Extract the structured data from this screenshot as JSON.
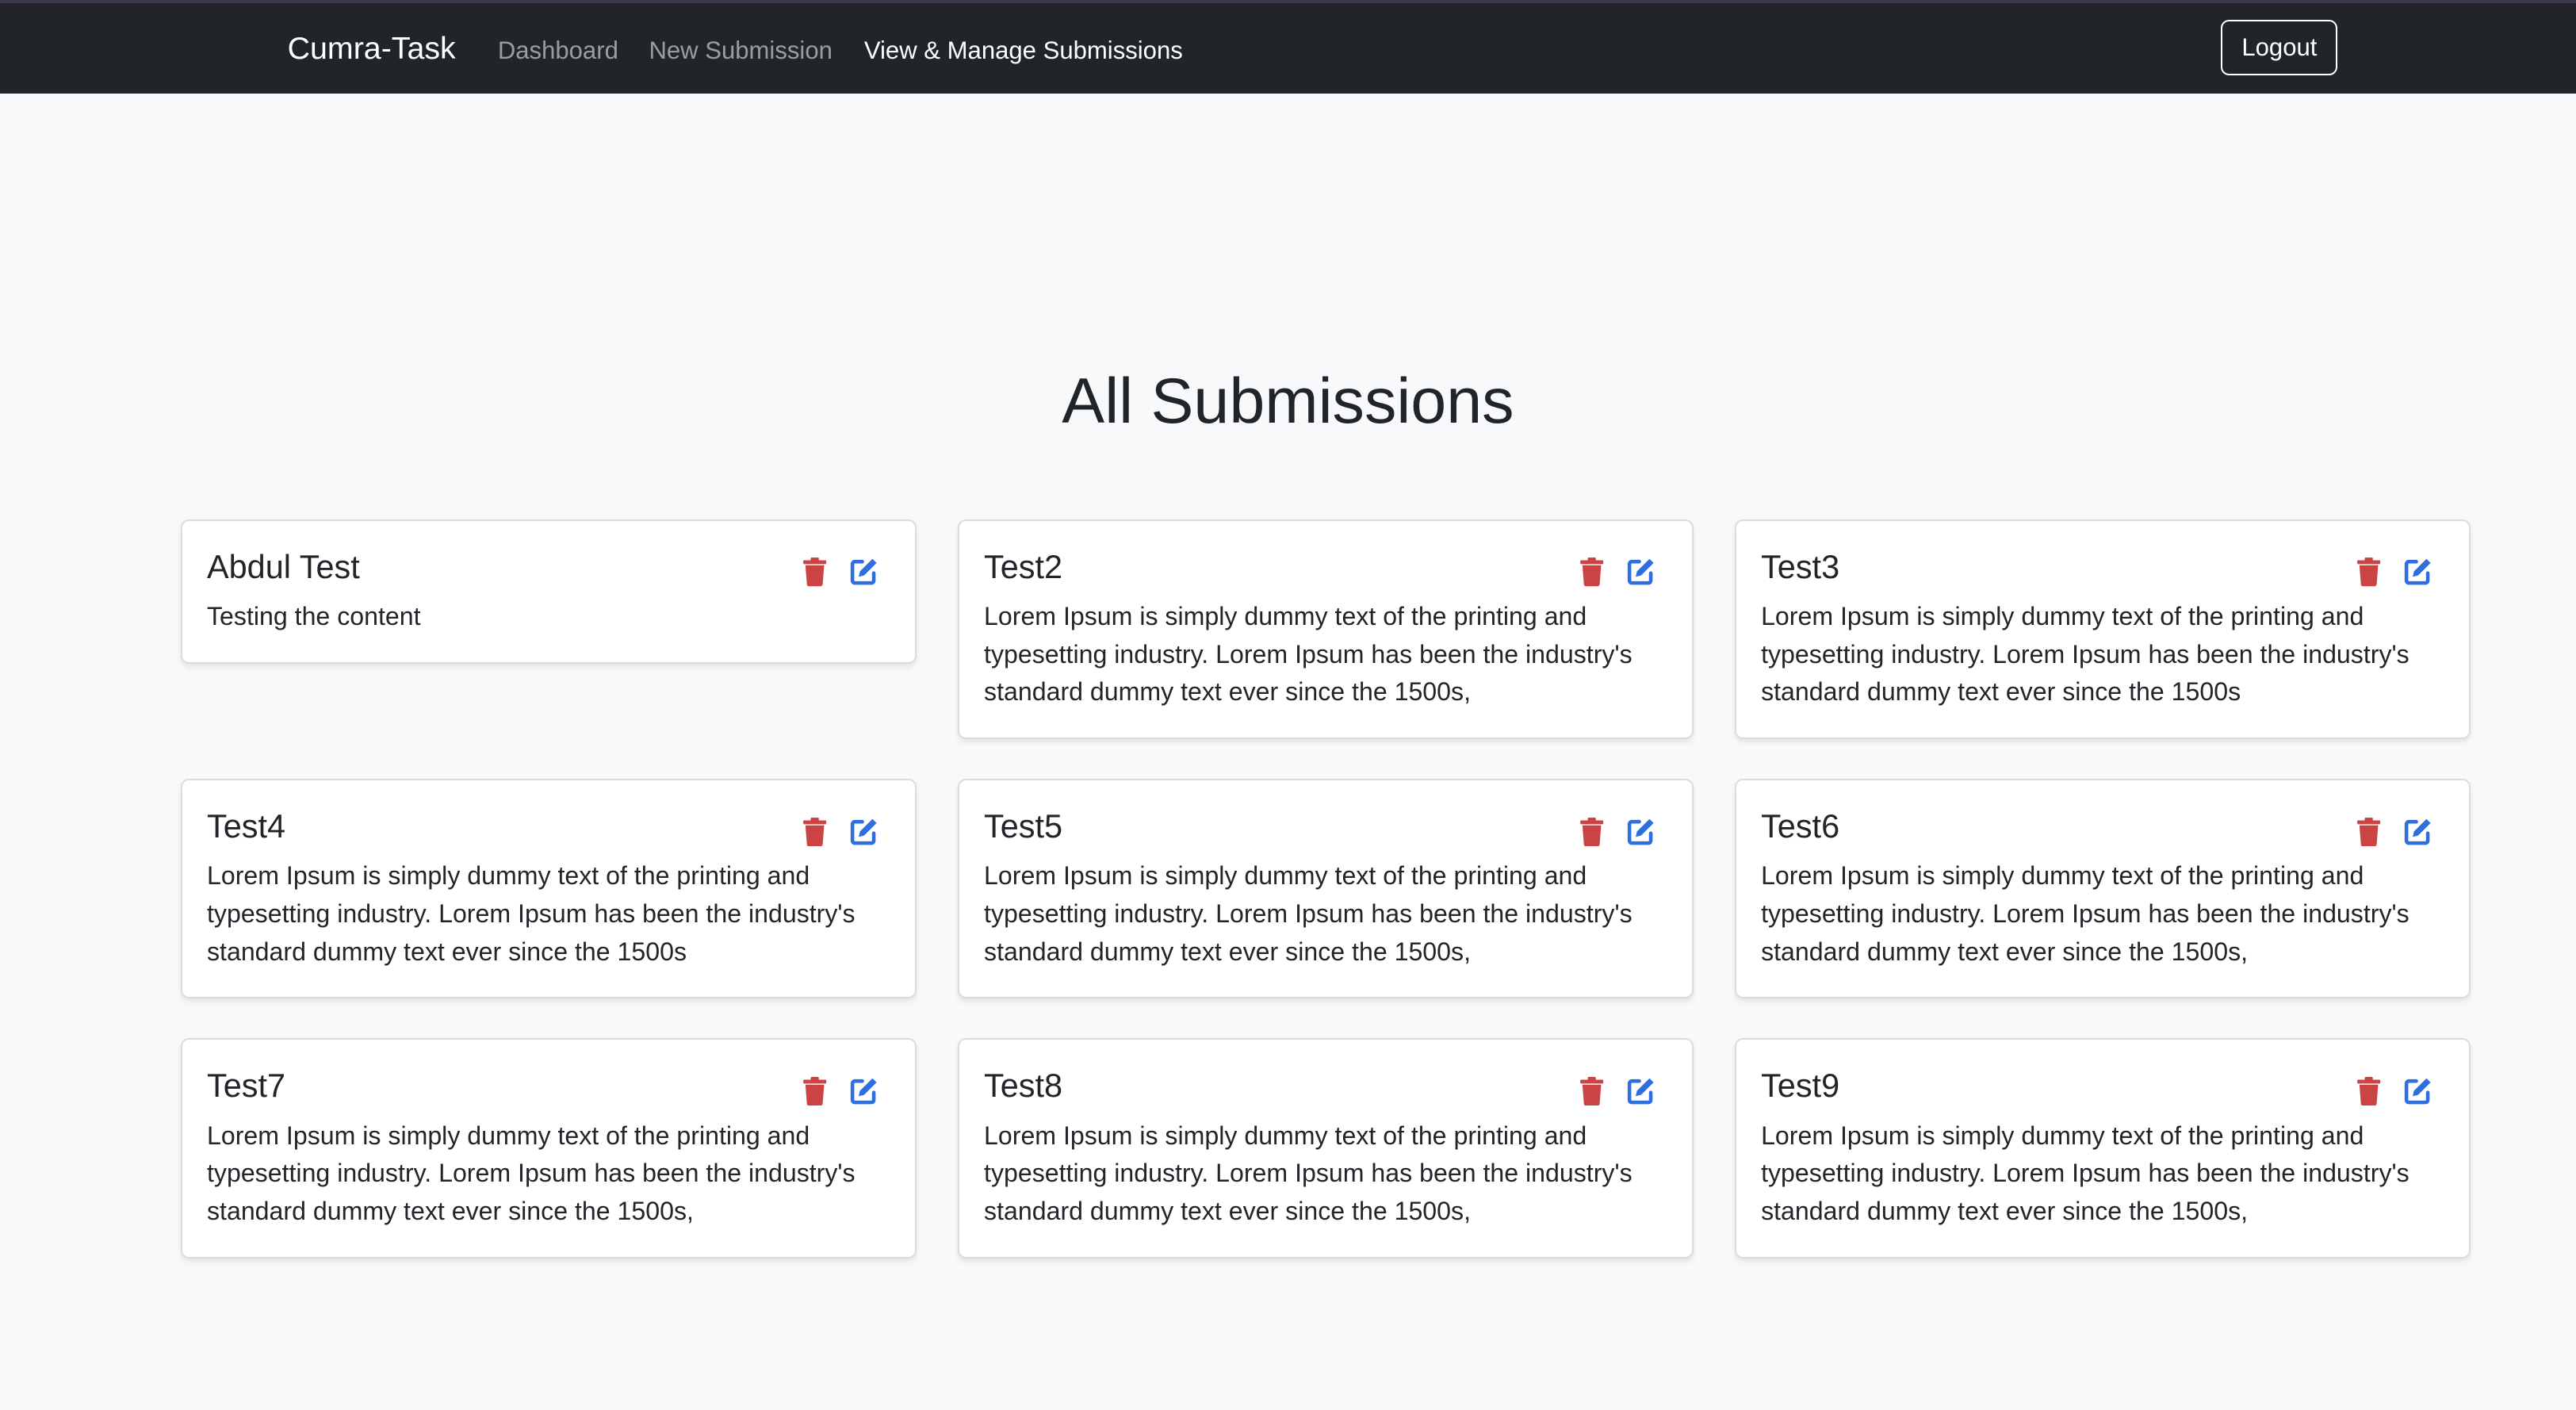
{
  "nav": {
    "brand": "Cumra-Task",
    "links": [
      "Dashboard",
      "New Submission",
      "View & Manage Submissions"
    ],
    "logout": "Logout"
  },
  "page": {
    "title": "All Submissions"
  },
  "colors": {
    "delete": "#cc4343",
    "edit": "#2d6ee0",
    "navbar": "#212529"
  },
  "icons": {
    "delete": "trash-icon",
    "edit": "edit-icon"
  },
  "submissions": [
    {
      "title": "Abdul Test",
      "body": "Testing the content"
    },
    {
      "title": "Test2",
      "body": "Lorem Ipsum is simply dummy text of the printing and typesetting industry. Lorem Ipsum has been the industry's standard dummy text ever since the 1500s,"
    },
    {
      "title": "Test3",
      "body": "Lorem Ipsum is simply dummy text of the printing and typesetting industry. Lorem Ipsum has been the industry's standard dummy text ever since the 1500s"
    },
    {
      "title": "Test4",
      "body": "Lorem Ipsum is simply dummy text of the printing and typesetting industry. Lorem Ipsum has been the industry's standard dummy text ever since the 1500s"
    },
    {
      "title": "Test5",
      "body": "Lorem Ipsum is simply dummy text of the printing and typesetting industry. Lorem Ipsum has been the industry's standard dummy text ever since the 1500s,"
    },
    {
      "title": "Test6",
      "body": "Lorem Ipsum is simply dummy text of the printing and typesetting industry. Lorem Ipsum has been the industry's standard dummy text ever since the 1500s,"
    },
    {
      "title": "Test7",
      "body": "Lorem Ipsum is simply dummy text of the printing and typesetting industry. Lorem Ipsum has been the industry's standard dummy text ever since the 1500s,"
    },
    {
      "title": "Test8",
      "body": "Lorem Ipsum is simply dummy text of the printing and typesetting industry. Lorem Ipsum has been the industry's standard dummy text ever since the 1500s,"
    },
    {
      "title": "Test9",
      "body": "Lorem Ipsum is simply dummy text of the printing and typesetting industry. Lorem Ipsum has been the industry's standard dummy text ever since the 1500s,"
    }
  ]
}
